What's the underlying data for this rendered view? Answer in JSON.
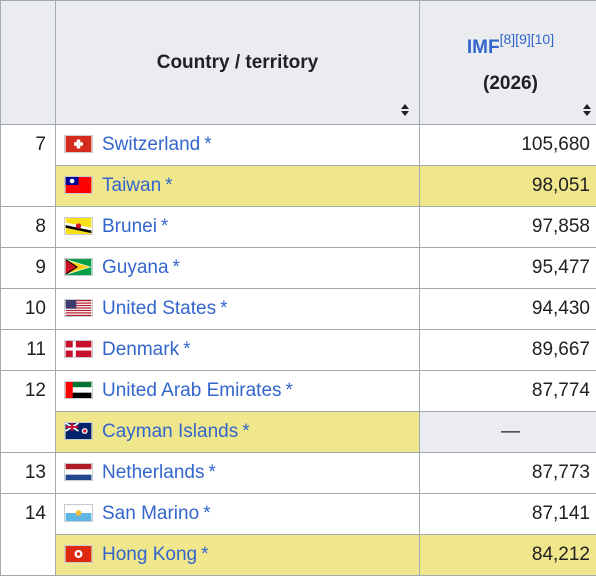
{
  "header": {
    "country_col": "Country / territory",
    "imf_label": "IMF",
    "imf_refs": "[8][9][10]",
    "imf_year": "(2026)"
  },
  "rows": [
    {
      "rank": "7",
      "country": "Switzerland",
      "flag": "ch-flag-icon",
      "value": "105,680",
      "highlight": false
    },
    {
      "rank": "",
      "country": "Taiwan",
      "flag": "tw-flag-icon",
      "value": "98,051",
      "highlight": true
    },
    {
      "rank": "8",
      "country": "Brunei",
      "flag": "bn-flag-icon",
      "value": "97,858",
      "highlight": false
    },
    {
      "rank": "9",
      "country": "Guyana",
      "flag": "gy-flag-icon",
      "value": "95,477",
      "highlight": false
    },
    {
      "rank": "10",
      "country": "United States",
      "flag": "us-flag-icon",
      "value": "94,430",
      "highlight": false
    },
    {
      "rank": "11",
      "country": "Denmark",
      "flag": "dk-flag-icon",
      "value": "89,667",
      "highlight": false
    },
    {
      "rank": "12",
      "country": "United Arab Emirates",
      "flag": "ae-flag-icon",
      "value": "87,774",
      "highlight": false
    },
    {
      "rank": "",
      "country": "Cayman Islands",
      "flag": "ky-flag-icon",
      "value": "—",
      "highlight": true
    },
    {
      "rank": "13",
      "country": "Netherlands",
      "flag": "nl-flag-icon",
      "value": "87,773",
      "highlight": false
    },
    {
      "rank": "14",
      "country": "San Marino",
      "flag": "sm-flag-icon",
      "value": "87,141",
      "highlight": false
    },
    {
      "rank": "",
      "country": "Hong Kong",
      "flag": "hk-flag-icon",
      "value": "84,212",
      "highlight": true
    }
  ],
  "asterisk": "*",
  "colors": {
    "link": "#3366cc",
    "highlight": "#f0e68c",
    "header_bg": "#eaecf0",
    "border": "#a2a9b1"
  }
}
